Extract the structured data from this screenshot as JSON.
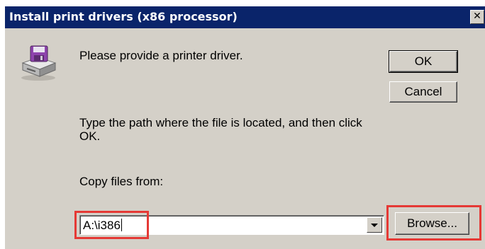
{
  "dialog": {
    "title": "Install print drivers (x86 processor)",
    "close_label": "✕",
    "icon": "printer-disk-icon",
    "message": "Please provide a printer driver.",
    "instruction": "Type the path where the file is located, and then click OK.",
    "copy_label": "Copy files from:",
    "copy_value": "A:\\i386",
    "ok_label": "OK",
    "cancel_label": "Cancel",
    "browse_label": "Browse..."
  },
  "colors": {
    "titlebar": "#0a246a",
    "dialog_background": "#d4d0c8",
    "highlight": "#e53935"
  }
}
